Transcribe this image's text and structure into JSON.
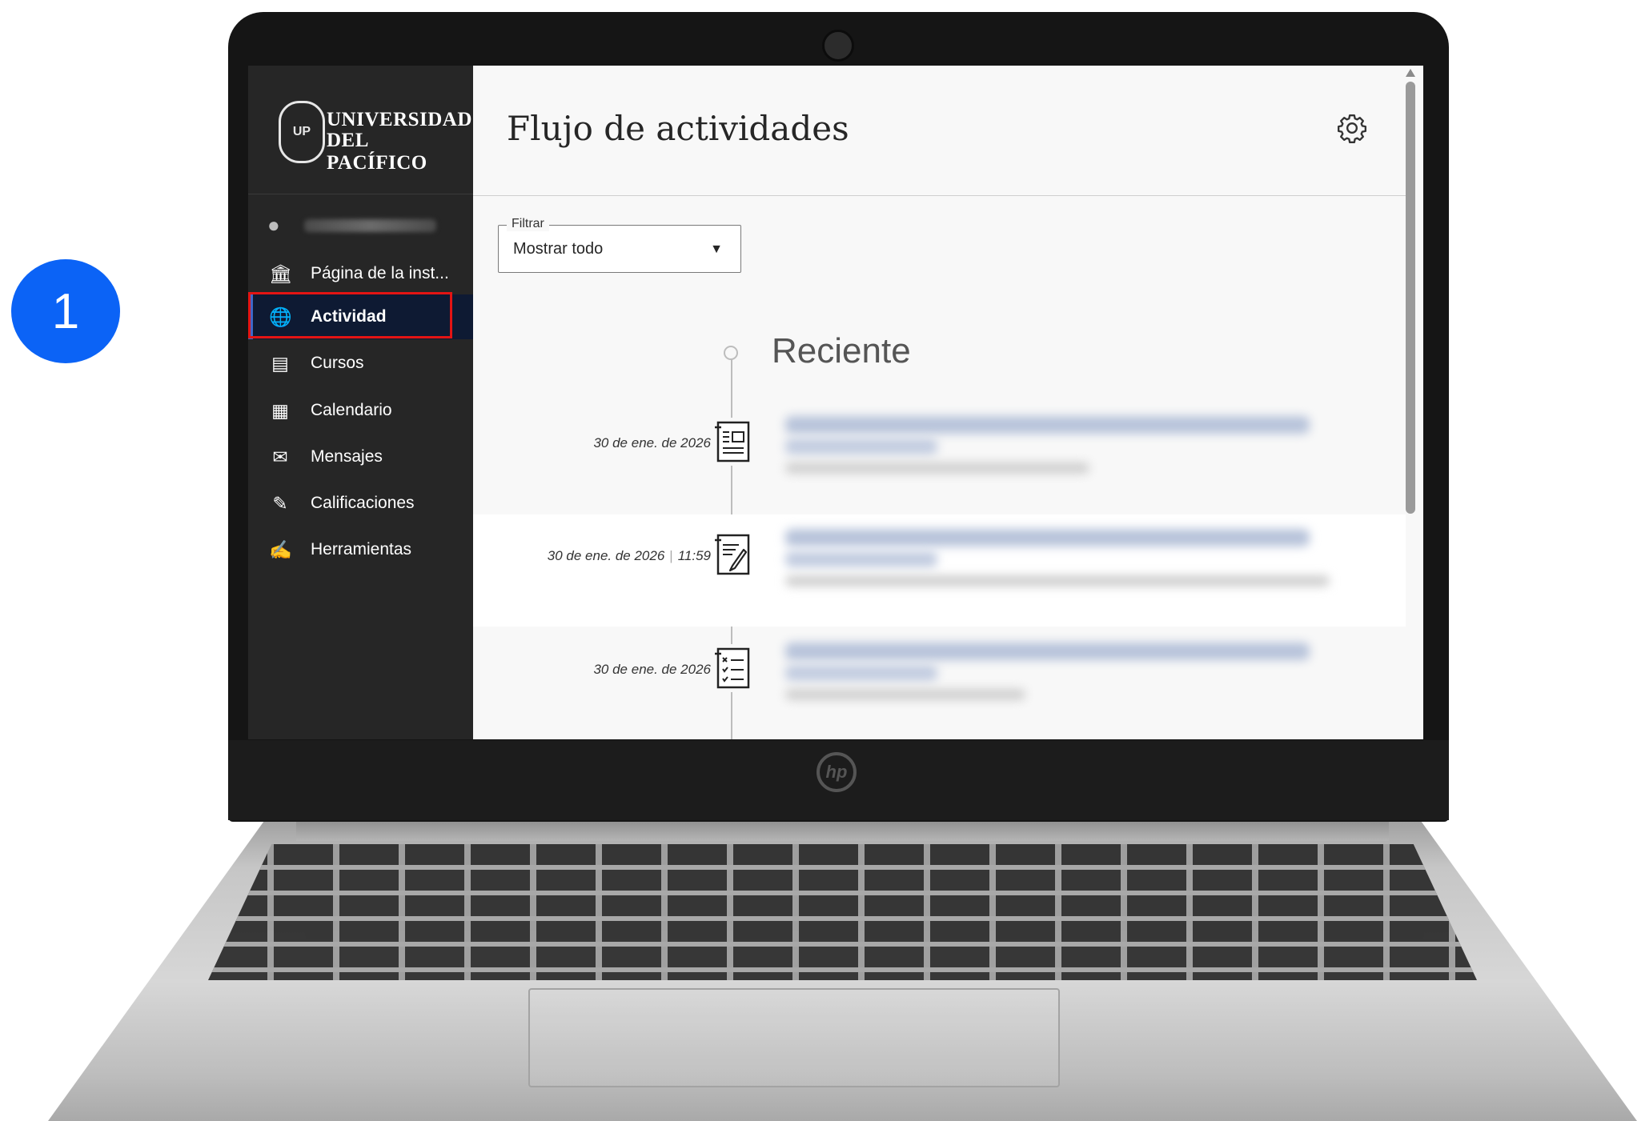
{
  "step_badge": "1",
  "university": {
    "line1": "UNIVERSIDAD",
    "line2": "DEL PACÍFICO"
  },
  "sidebar": {
    "items": [
      {
        "label": "Página de la inst...",
        "icon": "institution-icon"
      },
      {
        "label": "Actividad",
        "icon": "globe-icon",
        "active": true
      },
      {
        "label": "Cursos",
        "icon": "courses-icon"
      },
      {
        "label": "Calendario",
        "icon": "calendar-icon"
      },
      {
        "label": "Mensajes",
        "icon": "envelope-icon"
      },
      {
        "label": "Calificaciones",
        "icon": "grades-icon"
      },
      {
        "label": "Herramientas",
        "icon": "tools-icon"
      }
    ]
  },
  "header": {
    "title": "Flujo de actividades",
    "settings_icon": "gear-icon"
  },
  "filter": {
    "legend": "Filtrar",
    "value": "Mostrar todo"
  },
  "stream": {
    "section_title": "Reciente",
    "items": [
      {
        "date": "30 de ene. de 2026",
        "time": "",
        "icon": "announcement-icon"
      },
      {
        "date": "30 de ene. de 2026",
        "time": "11:59",
        "icon": "assignment-icon"
      },
      {
        "date": "30 de ene. de 2026",
        "time": "",
        "icon": "checklist-icon"
      }
    ]
  },
  "colors": {
    "accent": "#0b63f6",
    "sidebar_bg": "#262626",
    "active_bg": "#0e1a33",
    "highlight": "#e31414"
  }
}
